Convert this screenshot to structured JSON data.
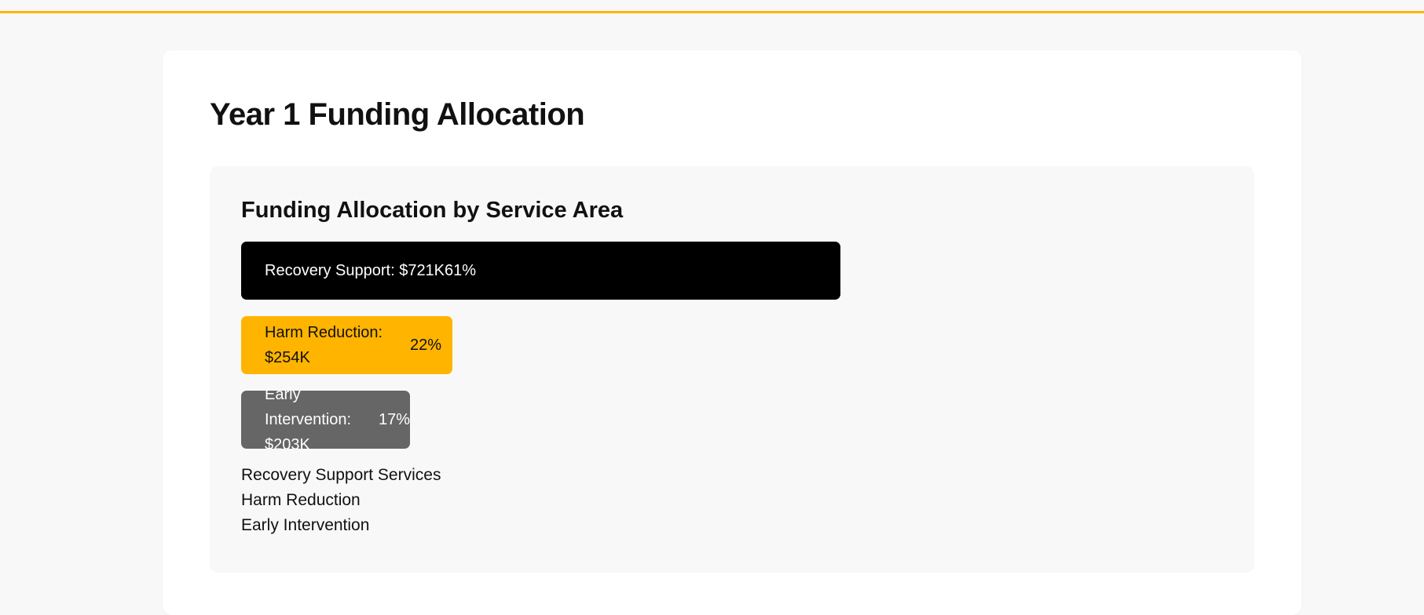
{
  "page": {
    "title": "Year 1 Funding Allocation"
  },
  "colors": {
    "accent": "#ffb400",
    "bar_colors": [
      "#000000",
      "#ffb400",
      "#666666"
    ],
    "bar_text_colors": [
      "#ffffff",
      "#111111",
      "#ffffff"
    ]
  },
  "chart_data": {
    "type": "bar",
    "orientation": "horizontal",
    "title": "Funding Allocation by Service Area",
    "categories": [
      "Recovery Support",
      "Harm Reduction",
      "Early Intervention"
    ],
    "amount_labels": [
      "Recovery Support: $721K",
      "Harm Reduction: $254K",
      "Early Intervention: $203K"
    ],
    "values": [
      721,
      254,
      203
    ],
    "unit": "$K",
    "percent_labels": [
      "61%",
      "22%",
      "17%"
    ],
    "legend": [
      "Recovery Support Services",
      "Harm Reduction",
      "Early Intervention"
    ],
    "xlim": [
      0,
      1000
    ]
  }
}
